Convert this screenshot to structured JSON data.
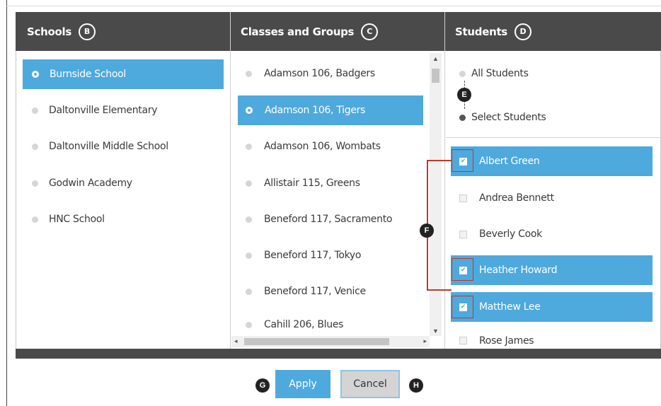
{
  "columns": {
    "schools": {
      "title": "Schools",
      "badge": "B"
    },
    "classes": {
      "title": "Classes and Groups",
      "badge": "C"
    },
    "students": {
      "title": "Students",
      "badge": "D"
    }
  },
  "schools": [
    {
      "label": "Burnside School",
      "selected": true
    },
    {
      "label": "Daltonville Elementary",
      "selected": false
    },
    {
      "label": "Daltonville Middle School",
      "selected": false
    },
    {
      "label": "Godwin Academy",
      "selected": false
    },
    {
      "label": "HNC School",
      "selected": false
    }
  ],
  "classes": [
    {
      "label": "Adamson 106, Badgers",
      "selected": false
    },
    {
      "label": "Adamson 106, Tigers",
      "selected": true
    },
    {
      "label": "Adamson 106, Wombats",
      "selected": false
    },
    {
      "label": "Allistair 115, Greens",
      "selected": false
    },
    {
      "label": "Beneford 117, Sacramento",
      "selected": false
    },
    {
      "label": "Beneford 117, Tokyo",
      "selected": false
    },
    {
      "label": "Beneford 117, Venice",
      "selected": false
    },
    {
      "label": "Cahill 206, Blues",
      "selected": false
    }
  ],
  "student_mode": {
    "all_label": "All Students",
    "select_label": "Select Students",
    "selected": "select"
  },
  "students": [
    {
      "label": "Albert Green",
      "checked": true
    },
    {
      "label": "Andrea Bennett",
      "checked": false
    },
    {
      "label": "Beverly Cook",
      "checked": false
    },
    {
      "label": "Heather Howard",
      "checked": true
    },
    {
      "label": "Matthew Lee",
      "checked": true
    },
    {
      "label": "Rose James",
      "checked": false
    }
  ],
  "callouts": {
    "e": "E",
    "f": "F",
    "g": "G",
    "h": "H"
  },
  "buttons": {
    "apply": "Apply",
    "cancel": "Cancel"
  },
  "icons": {
    "check": "✔",
    "scroll_up": "▲",
    "scroll_down": "▼",
    "scroll_left": "◂",
    "scroll_right": "▸"
  },
  "colors": {
    "header": "#4a4a4a",
    "accent": "#4ea9dd",
    "callout_line": "#c0392b"
  }
}
